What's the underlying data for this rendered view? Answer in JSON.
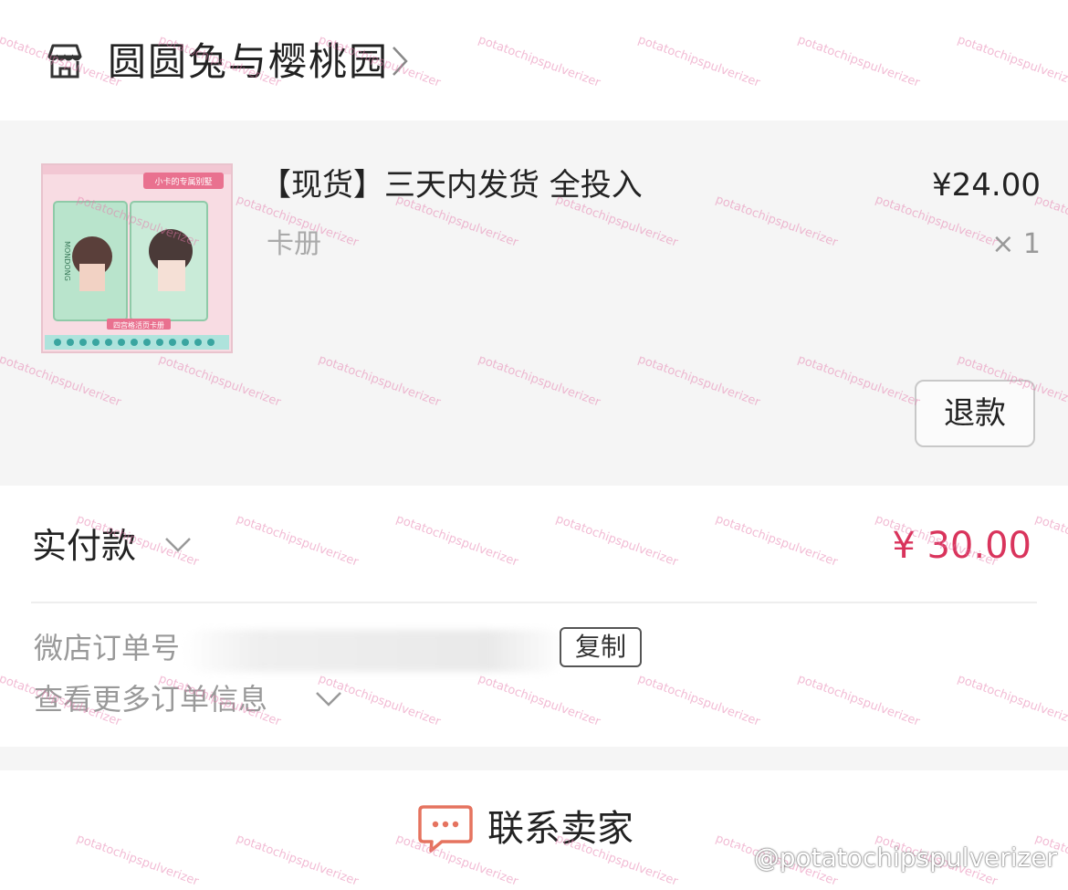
{
  "shop": {
    "name": "圆圆兔与樱桃园",
    "icon": "store-icon",
    "chevron_icon": "chevron-right-icon"
  },
  "product": {
    "title": "【现货】三天内发货 全投入",
    "variant": "卡册",
    "price": "¥24.00",
    "quantity": "× 1",
    "refund_label": "退款",
    "thumbnail_text": {
      "banner": "小卡的专属别墅",
      "footer": "四宫格活页卡册",
      "book_text": "MONDONG"
    }
  },
  "payment": {
    "label": "实付款",
    "amount": "¥ 30.00",
    "amount_color": "#d9345c"
  },
  "order": {
    "number_label": "微店订单号",
    "copy_label": "复制",
    "more_info_label": "查看更多订单信息"
  },
  "contact": {
    "label": "联系卖家",
    "icon": "chat-bubble-icon",
    "icon_color": "#e5735f"
  },
  "watermark": {
    "handle": "@potatochipspulverizer",
    "repeated_text": "potatochipspulverizer"
  }
}
